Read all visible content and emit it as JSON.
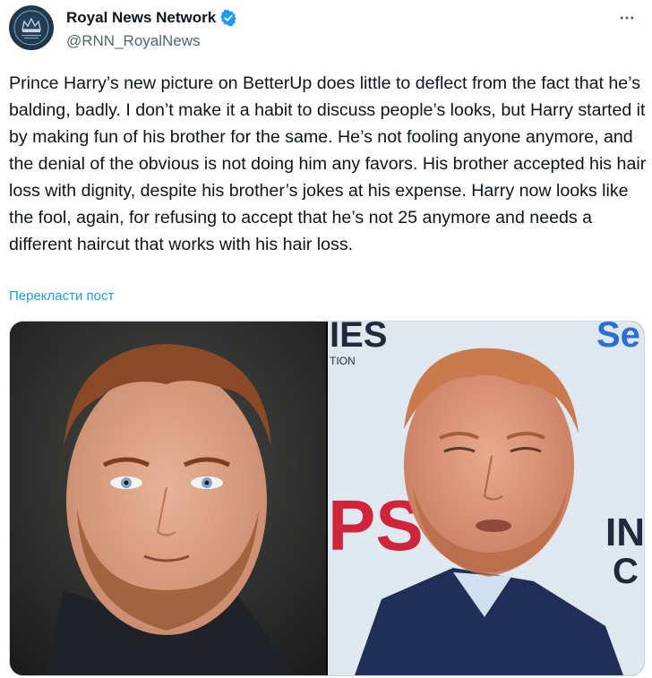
{
  "author": {
    "display_name": "Royal News Network",
    "handle": "@RNN_RoyalNews",
    "verified": true,
    "avatar_icon": "crown-logo-icon",
    "avatar_color": "#1d3448"
  },
  "tweet": {
    "text": "Prince Harry’s new picture on BetterUp does little to deflect from the fact that he’s balding, badly. I don’t make it a habit to discuss people’s looks, but Harry started it by making fun of his brother for the same. He’s not fooling anyone anymore, and the denial of the obvious is not doing him any favors. His brother accepted his hair loss with dignity, despite his brother’s jokes at his expense. Harry now looks like the fool, again, for refusing to accept that he’s not 25 anymore and needs a different haircut that works with his hair loss.",
    "translate_label": "Перекласти пост"
  },
  "media": {
    "left_photo": {
      "kind": "portrait-photo",
      "background": "#2a2a2a"
    },
    "right_photo": {
      "kind": "event-photo",
      "background": "#dfe7ef",
      "backdrop_text_top": "IES",
      "backdrop_text_sub": "TION",
      "backdrop_text_right": "Se",
      "backdrop_text_red": "PS",
      "backdrop_text_right2": "IN",
      "backdrop_text_right3": "C"
    }
  },
  "colors": {
    "accent": "#1d9bf0",
    "text_primary": "#0f1419",
    "text_secondary": "#536471",
    "verified_badge": "#1d9bf0"
  }
}
